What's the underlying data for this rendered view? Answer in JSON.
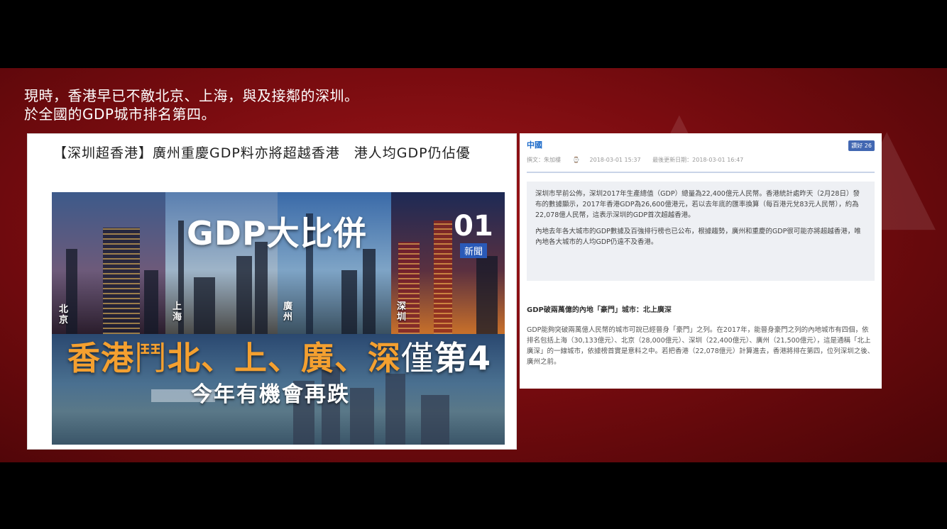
{
  "caption": {
    "line1": "現時，香港早已不敵北京、上海，與及接鄰的深圳。",
    "line2": "於全國的GDP城市排名第四。"
  },
  "left_article": {
    "headline": "【深圳超香港】廣州重慶GDP料亦將超越香港　港人均GDP仍佔優",
    "hero": {
      "title": "GDP大比併",
      "logo_number": "01",
      "logo_label": "新聞",
      "cities": [
        "北京",
        "上海",
        "廣州",
        "深圳"
      ],
      "main_part1": "香港",
      "main_vs": "鬥",
      "main_part2": "北、上、廣、深",
      "main_part3": "僅",
      "main_part4": "第4",
      "subtitle": "今年有機會再跌"
    }
  },
  "right_article": {
    "category": "中國",
    "like_label": "讚好 26",
    "author": "撰文：朱加樓",
    "published": "2018-03-01 15:37",
    "updated": "最後更新日期：2018-03-01 16:47",
    "quote_p1": "深圳市早前公佈，深圳2017年生產總值（GDP）總量為22,400億元人民幣。香港統計處昨天（2月28日）發布的數據顯示，2017年香港GDP為26,600億港元，若以去年底的匯率換算（每百港元兌83元人民幣），約為22,078億人民幣，這表示深圳的GDP首次超越香港。",
    "quote_p2": "內地去年各大城市的GDP數據及百強排行榜也已公布，根據趨勢，廣州和重慶的GDP很可能亦將超越香港，唯內地各大城市的人均GDP仍遠不及香港。",
    "subhead": "GDP破兩萬億的內地「豪門」城市：北上廣深",
    "body": "GDP能夠突破兩萬億人民幣的城市可說已經晉身「豪門」之列。在2017年，能晉身豪門之列的內地城市有四個，依排名包括上海（30,133億元）、北京（28,000億元）、深圳（22,400億元）、廣州（21,500億元），這是通稱「北上廣深」的一線城市，依據榜首實是意料之中。若把香港（22,078億元）計算進去，香港將排在第四，位列深圳之後、廣州之前。"
  },
  "colors": {
    "background": "#7a0c10",
    "accent_orange": "#f4a030",
    "link_blue": "#1b6ac9"
  }
}
